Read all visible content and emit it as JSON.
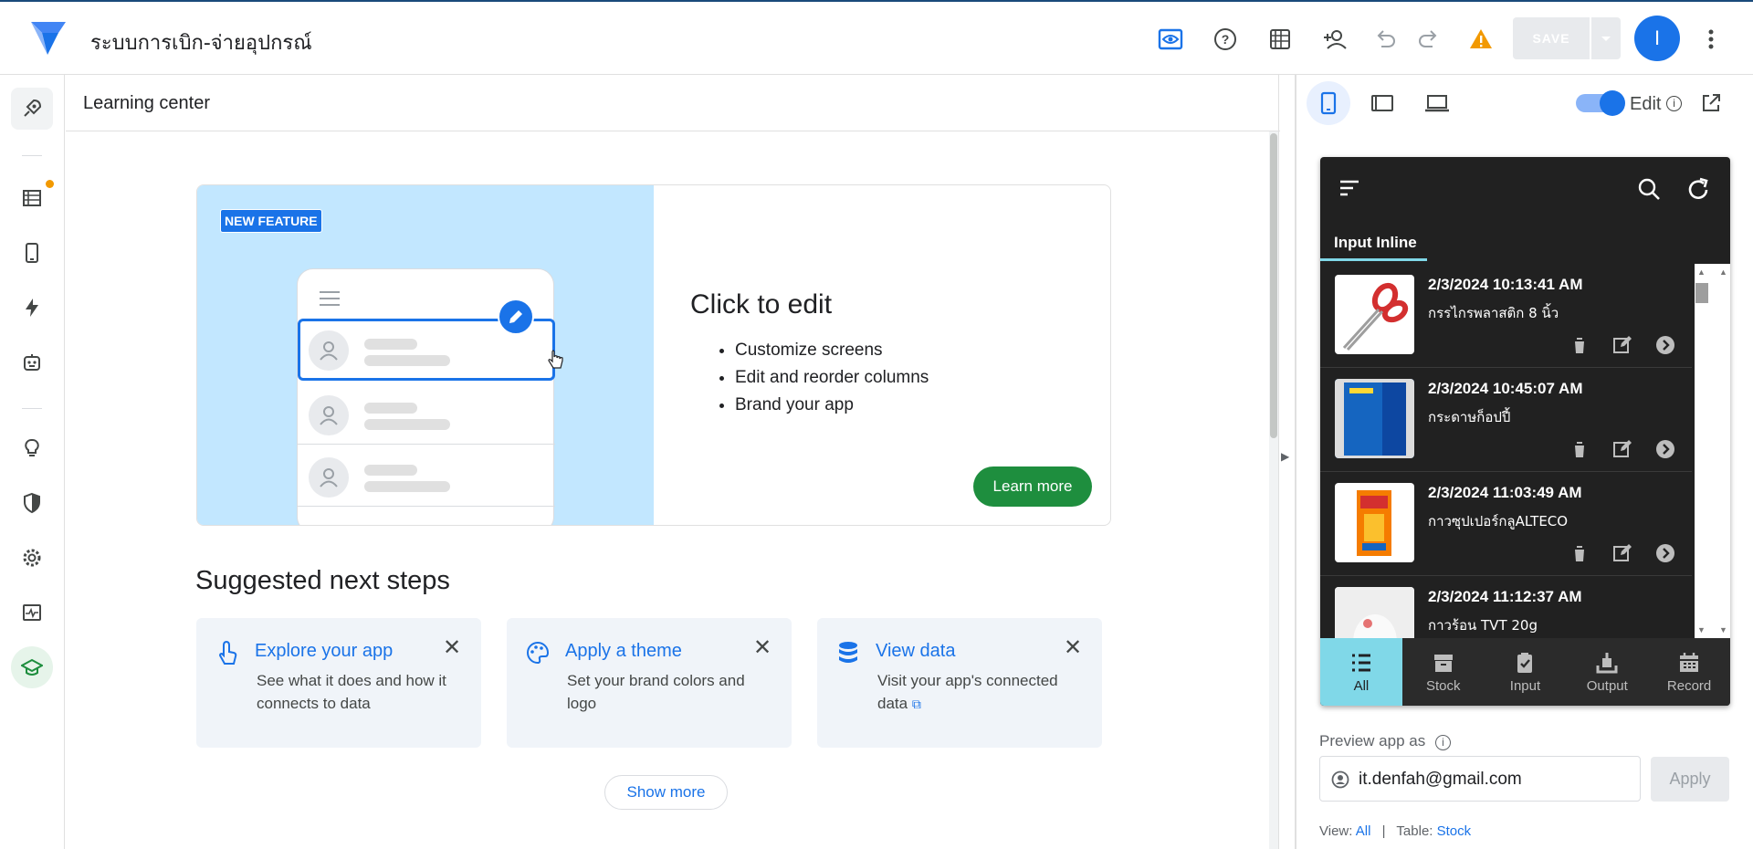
{
  "header": {
    "app_title": "ระบบการเบิก-จ่ายอุปกรณ์",
    "save_label": "SAVE",
    "avatar_initial": "I"
  },
  "main": {
    "title": "Learning center",
    "feature": {
      "badge": "NEW FEATURE",
      "title": "Click to edit",
      "bullets": [
        "Customize screens",
        "Edit and reorder columns",
        "Brand your app"
      ],
      "cta": "Learn more"
    },
    "suggested_title": "Suggested next steps",
    "cards": [
      {
        "title": "Explore your app",
        "desc": "See what it does and how it connects to data",
        "icon": "touch-icon"
      },
      {
        "title": "Apply a theme",
        "desc": "Set your brand colors and logo",
        "icon": "palette-icon"
      },
      {
        "title": "View data",
        "desc": "Visit your app's connected data",
        "icon": "database-icon"
      }
    ],
    "show_more": "Show more"
  },
  "preview": {
    "edit_label": "Edit",
    "tab": "Input Inline",
    "rows": [
      {
        "date": "2/3/2024 10:13:41 AM",
        "name": "กรรไกรพลาสติก 8 นิ้ว"
      },
      {
        "date": "2/3/2024 10:45:07 AM",
        "name": "กระดาษก็อปปี้"
      },
      {
        "date": "2/3/2024 11:03:49 AM",
        "name": "กาวซุปเปอร์กลูALTECO"
      },
      {
        "date": "2/3/2024 11:12:37 AM",
        "name": "กาวร้อน TVT 20g"
      }
    ],
    "nav": [
      "All",
      "Stock",
      "Input",
      "Output",
      "Record"
    ],
    "preview_as_label": "Preview app as",
    "email": "it.denfah@gmail.com",
    "apply_label": "Apply",
    "view_label": "View:",
    "view_value": "All",
    "sep": "|",
    "table_label": "Table:",
    "table_value": "Stock"
  },
  "colors": {
    "accent": "#1a73e8",
    "green": "#1e8e3e",
    "teal": "#80d8e8",
    "warning": "#f29900"
  }
}
